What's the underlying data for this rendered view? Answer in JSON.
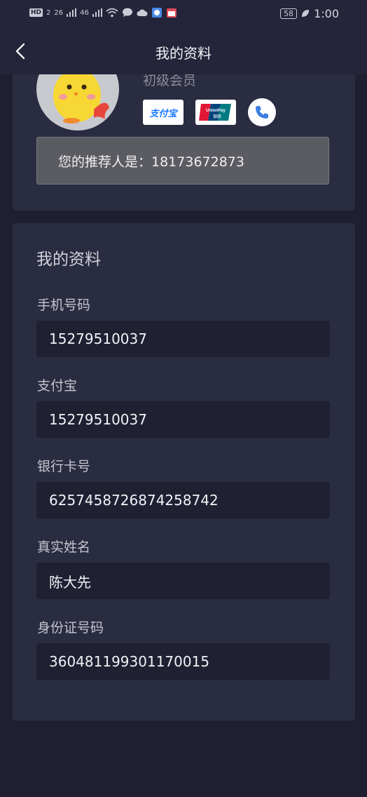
{
  "status_bar": {
    "left_items": [
      "HD",
      "2",
      "26",
      "46"
    ],
    "battery": "58",
    "time": "1:00"
  },
  "nav": {
    "title": "我的资料"
  },
  "profile": {
    "level": "初级会员",
    "alipay_logo_text": "支付宝",
    "unionpay_logo_text": "UnionPay 银联",
    "referrer_text": "您的推荐人是：18173672873"
  },
  "details": {
    "section_title": "我的资料",
    "fields": [
      {
        "label": "手机号码",
        "value": "15279510037"
      },
      {
        "label": "支付宝",
        "value": "15279510037"
      },
      {
        "label": "银行卡号",
        "value": "6257458726874258742"
      },
      {
        "label": "真实姓名",
        "value": "陈大先"
      },
      {
        "label": "身份证号码",
        "value": "360481199301170015"
      }
    ]
  },
  "colors": {
    "background": "#1e1f31",
    "card": "#2a2c41",
    "input_bg": "#1f2032",
    "referrer_bg": "#5b5c62"
  }
}
